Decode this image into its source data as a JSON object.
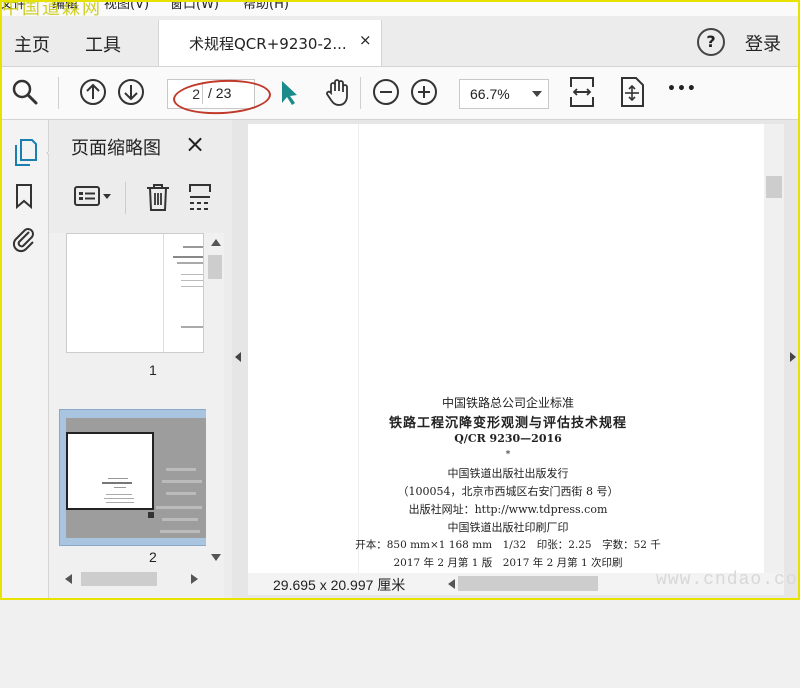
{
  "watermark_top": "中国道森网",
  "menubar": {
    "items": [
      "文件",
      "编辑",
      "视图(V)",
      "窗口(W)",
      "帮助(H)"
    ]
  },
  "tabbar": {
    "home": "主页",
    "tools": "工具",
    "doc_tab": "术规程QCR+9230-2...",
    "close": "×",
    "help": "?",
    "login": "登录"
  },
  "toolbar": {
    "page_current": "2",
    "page_total": "/ 23",
    "zoom": "66.7%",
    "more": "•••"
  },
  "sidepanel": {
    "title": "页面缩略图",
    "close": "×",
    "thumbnails": [
      {
        "page": "1"
      },
      {
        "page": "2"
      }
    ]
  },
  "document": {
    "lines": [
      "中国铁路总公司企业标准",
      "铁路工程沉降变形观测与评估技术规程",
      "Q/CR 9230—2016",
      "*",
      "中国铁道出版社出版发行",
      "（100054，北京市西城区右安门西街 8 号）",
      "出版社网址：http://www.tdpress.com",
      "中国铁道出版社印刷厂印",
      "开本：850 mm×1 168 mm　1/32　印张：2.25　字数：52 千",
      "2017 年 2 月第 1 版　2017 年 2 月第 1 次印刷"
    ],
    "page_size": "29.695 x 20.997 厘米"
  },
  "watermark_bottom": "www.cndao.com",
  "colors": {
    "annotation_oval": "#c0392b",
    "frame": "#e8e200",
    "cursor_teal": "#1a8a8a",
    "selection": "#a8c4df"
  }
}
